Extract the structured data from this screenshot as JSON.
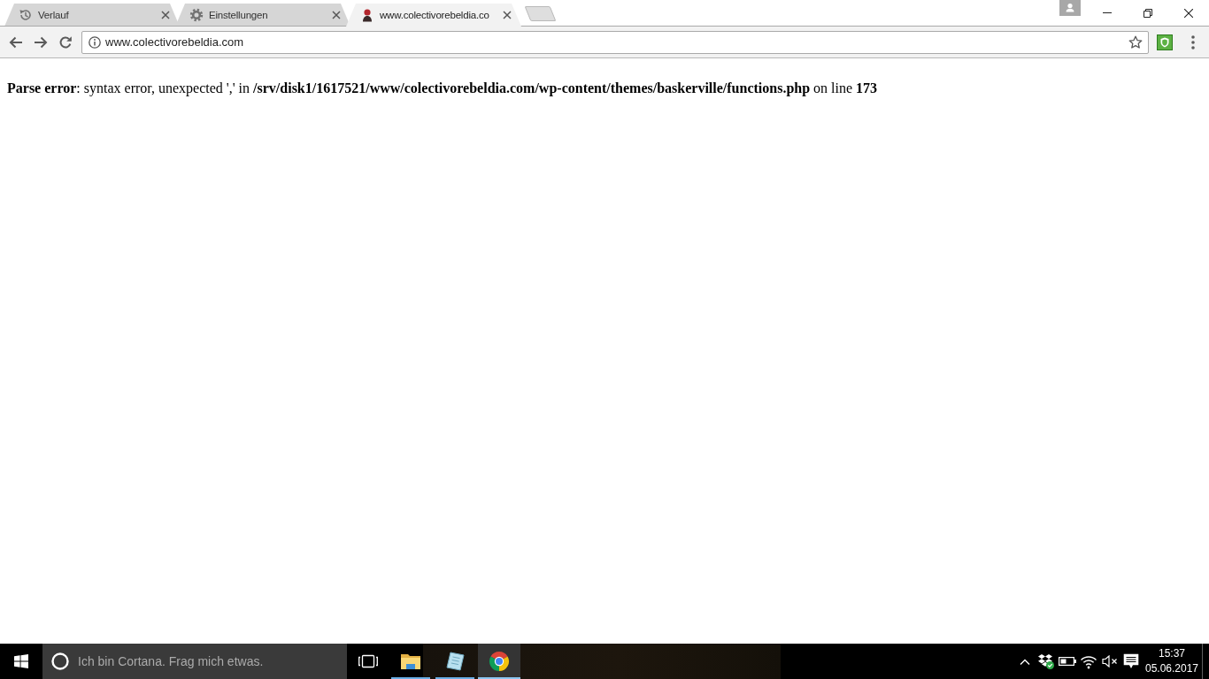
{
  "browser": {
    "tabs": [
      {
        "kind": "history",
        "label": "Verlauf",
        "selected": false
      },
      {
        "kind": "settings",
        "label": "Einstellungen",
        "selected": false
      },
      {
        "kind": "site",
        "label": "www.colectivorebeldia.co",
        "selected": true
      }
    ],
    "address_bar": {
      "value": "www.colectivorebeldia.com"
    }
  },
  "page": {
    "error": "**Parse error**: syntax error, unexpected ',' in **/srv/disk1/1617521/www/colectivorebeldia.com/wp-content/themes/baskerville/functions.php** on line **173**"
  },
  "taskbar": {
    "search": {
      "placeholder": "Ich bin Cortana. Frag mich etwas."
    },
    "apps": [
      {
        "kind": "folder",
        "running": true,
        "selected": false
      },
      {
        "kind": "notepad",
        "running": true,
        "selected": false
      },
      {
        "kind": "browser",
        "running": true,
        "selected": true
      }
    ],
    "clock": {
      "time": "15:37",
      "date": "05.06.2017"
    }
  }
}
